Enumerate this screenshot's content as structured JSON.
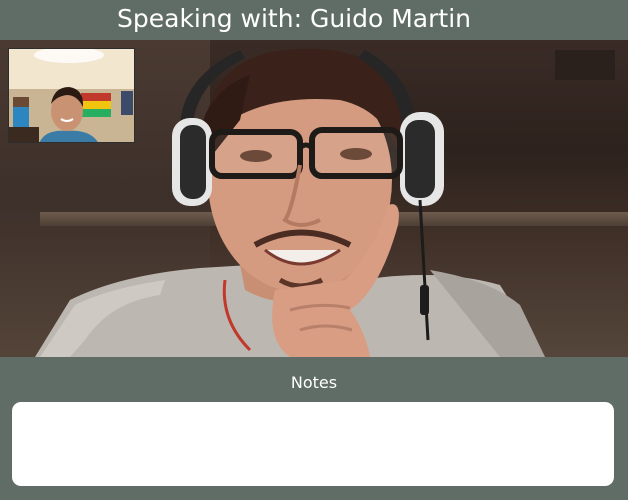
{
  "header": {
    "title": "Speaking with: Guido Martin"
  },
  "notes": {
    "label": "Notes",
    "value": "",
    "placeholder": ""
  },
  "colors": {
    "background": "#5f6d66",
    "header_text": "#ffffff",
    "notes_field": "#ffffff"
  }
}
